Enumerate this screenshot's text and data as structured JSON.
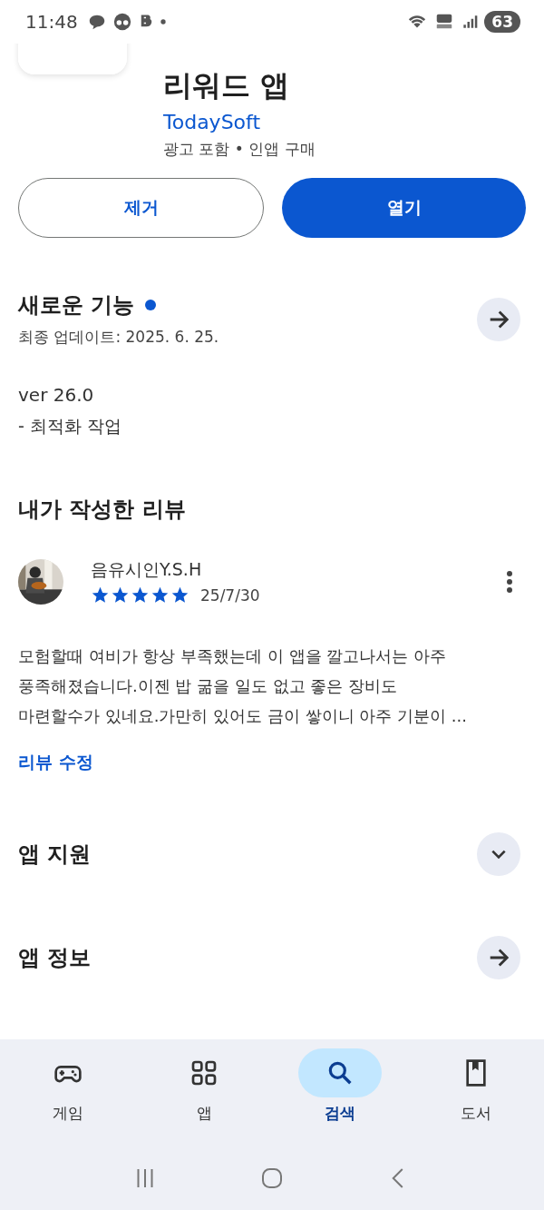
{
  "status_bar": {
    "time": "11:48",
    "battery": "63"
  },
  "app": {
    "title_line": "리워드 앱",
    "developer": "TodaySoft",
    "meta": "광고 포함 • 인앱 구매"
  },
  "buttons": [
    {
      "label": "제거",
      "kind": "outline"
    },
    {
      "label": "열기",
      "kind": "filled"
    }
  ],
  "whats_new": {
    "title": "새로운 기능",
    "has_update": true,
    "date": "최종 업데이트: 2025. 6. 25.",
    "version": "ver 26.0",
    "notes": "- 최적화 작업"
  },
  "my_review": {
    "heading": "내가 작성한 리뷰",
    "author": "음유시인Y.S.H",
    "stars": 5,
    "date": "25/7/30",
    "body": "모험할때 여비가 항상 부족했는데 이 앱을 깔고나서는 아주\n풍족해졌습니다.이젠 밥 굶을 일도 없고 좋은 장비도\n마련할수가 있네요.가만히 있어도 금이 쌓이니 아주 기분이 ...",
    "edit_link": "리뷰 수정"
  },
  "sections": [
    {
      "title": "앱 지원",
      "kind": "chevron"
    },
    {
      "title": "앱 정보",
      "kind": "arrow"
    }
  ],
  "bottom_nav": [
    {
      "label": "게임",
      "selected": false
    },
    {
      "label": "앱",
      "selected": false
    },
    {
      "label": "검색",
      "selected": true
    },
    {
      "label": "도서",
      "selected": false
    }
  ]
}
